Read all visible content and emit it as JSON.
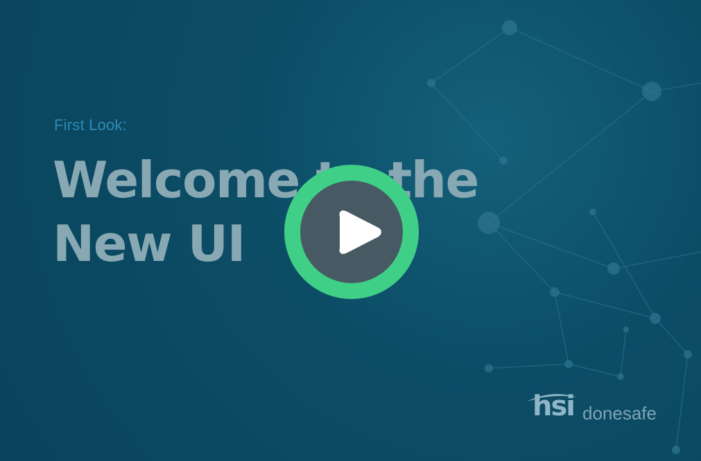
{
  "video": {
    "subtitle": "First Look:",
    "title_line1": "Welcome to the",
    "title_line2": "New UI",
    "play_icon": "play-icon"
  },
  "brand": {
    "mark": "hsi",
    "name": "donesafe"
  },
  "colors": {
    "background": "#0b4a62",
    "play_ring": "#3fcf86",
    "play_fill": "#475a63",
    "subtitle": "#2f8ab6",
    "title": "#88a9b3"
  }
}
